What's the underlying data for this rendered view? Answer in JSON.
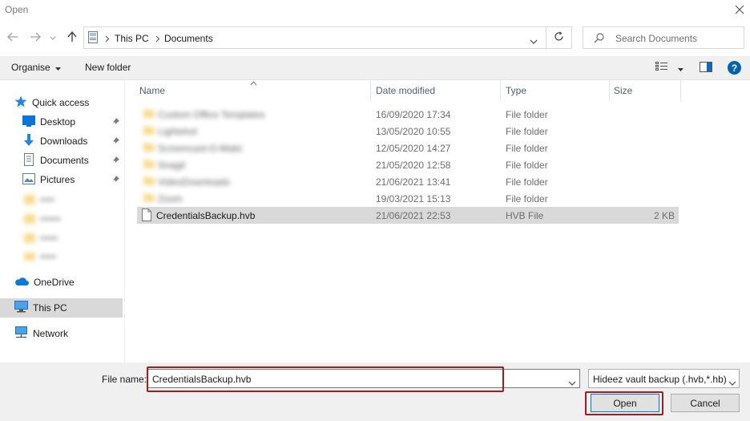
{
  "window": {
    "title": "Open"
  },
  "breadcrumb": {
    "items": [
      "This PC",
      "Documents"
    ]
  },
  "search": {
    "placeholder": "Search Documents"
  },
  "toolbar": {
    "organise_label": "Organise",
    "new_folder_label": "New folder"
  },
  "sidebar": {
    "items": [
      {
        "label": "Quick access",
        "icon": "star-icon"
      },
      {
        "label": "Desktop",
        "icon": "desktop-icon",
        "pinned": true
      },
      {
        "label": "Downloads",
        "icon": "download-icon",
        "pinned": true
      },
      {
        "label": "Documents",
        "icon": "documents-icon",
        "pinned": true
      },
      {
        "label": "Pictures",
        "icon": "pictures-icon",
        "pinned": true
      },
      {
        "label": "OneDrive",
        "icon": "cloud-icon"
      },
      {
        "label": "This PC",
        "icon": "computer-icon",
        "selected": true
      },
      {
        "label": "Network",
        "icon": "network-icon"
      }
    ]
  },
  "columns": {
    "name": "Name",
    "date_modified": "Date modified",
    "type": "Type",
    "size": "Size"
  },
  "files": [
    {
      "name": "Custom Office Templates",
      "date": "16/09/2020 17:34",
      "type": "File folder",
      "size": "",
      "blurred": true
    },
    {
      "name": "Lightshot",
      "date": "13/05/2020 10:55",
      "type": "File folder",
      "size": "",
      "blurred": true
    },
    {
      "name": "Screencast-O-Matic",
      "date": "12/05/2020 14:27",
      "type": "File folder",
      "size": "",
      "blurred": true
    },
    {
      "name": "Snagit",
      "date": "21/05/2020 12:58",
      "type": "File folder",
      "size": "",
      "blurred": true
    },
    {
      "name": "VideoDownloads",
      "date": "21/06/2021 13:41",
      "type": "File folder",
      "size": "",
      "blurred": true
    },
    {
      "name": "Zoom",
      "date": "19/03/2021 15:13",
      "type": "File folder",
      "size": "",
      "blurred": true
    },
    {
      "name": "CredentialsBackup.hvb",
      "date": "21/06/2021 22:53",
      "type": "HVB File",
      "size": "2 KB",
      "selected": true
    }
  ],
  "bottom": {
    "file_name_label": "File name:",
    "file_name_value": "CredentialsBackup.hvb",
    "file_type_value": "Hideez vault backup (.hvb,*.hb)",
    "open_label": "Open",
    "cancel_label": "Cancel"
  },
  "colors": {
    "highlight": "#a61c1c",
    "selected_row": "#d9d9d9",
    "selected_nav": "#cce8ff",
    "accent_blue": "#0078d7"
  }
}
